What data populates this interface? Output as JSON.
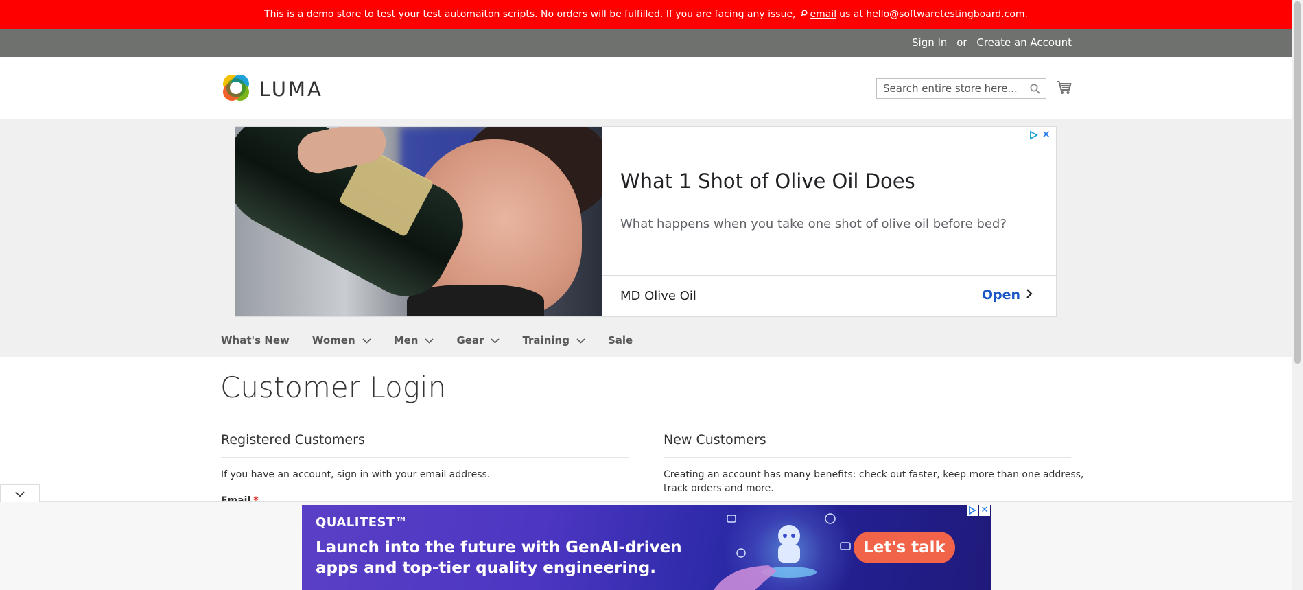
{
  "demo_banner": {
    "text_before": "This is a demo store to test your test automaiton scripts. No orders will be fulfilled. If you are facing any issue,",
    "link_text": "email",
    "text_after": "us at hello@softwaretestingboard.com."
  },
  "header": {
    "sign_in": "Sign In",
    "or": "or",
    "create_account": "Create an Account",
    "logo_text": "LUMA",
    "search_placeholder": "Search entire store here...",
    "icons": {
      "search": "search-icon",
      "cart": "cart-icon",
      "logo": "luma-logo-icon"
    }
  },
  "top_ad": {
    "headline": "What 1 Shot of Olive Oil Does",
    "description": "What happens when you take one shot of olive oil before bed?",
    "advertiser": "MD Olive Oil",
    "cta": "Open",
    "close": "✕"
  },
  "nav": {
    "items": [
      {
        "label": "What's New",
        "has_dropdown": false
      },
      {
        "label": "Women",
        "has_dropdown": true
      },
      {
        "label": "Men",
        "has_dropdown": true
      },
      {
        "label": "Gear",
        "has_dropdown": true
      },
      {
        "label": "Training",
        "has_dropdown": true
      },
      {
        "label": "Sale",
        "has_dropdown": false
      }
    ]
  },
  "main": {
    "page_title": "Customer Login",
    "registered": {
      "title": "Registered Customers",
      "text": "If you have an account, sign in with your email address.",
      "email_label": "Email",
      "required_mark": "*"
    },
    "new_customers": {
      "title": "New Customers",
      "text_line1": "Creating an account has many benefits: check out faster, keep more than one address,",
      "text_line2": "track orders and more."
    }
  },
  "bottom_ad": {
    "brand": "QUALITEST™",
    "line1": "Launch into the future with GenAI-driven",
    "line2": "apps and top-tier quality engineering.",
    "cta": "Let's talk",
    "close": "✕"
  },
  "colors": {
    "demo_banner": "#ff0000",
    "header_bar": "#6e716e",
    "band": "#f0f0f0",
    "ad_cta": "#1a56c6",
    "bottom_ad_cta": "#f26449",
    "required": "#e02b27"
  }
}
